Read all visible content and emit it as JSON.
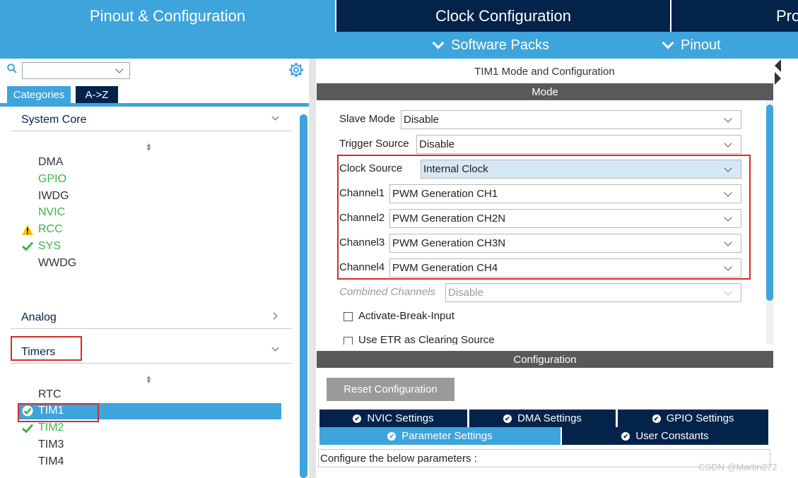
{
  "top_tabs": {
    "pinout": "Pinout & Configuration",
    "clock": "Clock Configuration",
    "project": "Project Manager"
  },
  "subbar": {
    "software_packs": "Software Packs",
    "pinout": "Pinout"
  },
  "left": {
    "search_value": "",
    "tabs": [
      "Categories",
      "A->Z"
    ],
    "sections": {
      "system_core": "System Core",
      "analog": "Analog",
      "timers": "Timers"
    },
    "system_core_items": [
      "DMA",
      "GPIO",
      "IWDG",
      "NVIC",
      "RCC",
      "SYS",
      "WWDG"
    ],
    "timer_items": [
      "RTC",
      "TIM1",
      "TIM2",
      "TIM3",
      "TIM4"
    ]
  },
  "right": {
    "title": "TIM1 Mode and Configuration",
    "mode_header": "Mode",
    "config_header": "Configuration",
    "fields": {
      "slave_mode": {
        "label": "Slave Mode",
        "value": "Disable"
      },
      "trigger_source": {
        "label": "Trigger Source",
        "value": "Disable"
      },
      "clock_source": {
        "label": "Clock Source",
        "value": "Internal Clock"
      },
      "channel1": {
        "label": "Channel1",
        "value": "PWM Generation CH1"
      },
      "channel2": {
        "label": "Channel2",
        "value": "PWM Generation CH2N"
      },
      "channel3": {
        "label": "Channel3",
        "value": "PWM Generation CH3N"
      },
      "channel4": {
        "label": "Channel4",
        "value": "PWM Generation CH4"
      },
      "combined": {
        "label": "Combined Channels",
        "value": "Disable"
      }
    },
    "checkboxes": {
      "activate_break": "Activate-Break-Input",
      "use_etr": "Use ETR as Clearing Source"
    },
    "reset_button": "Reset Configuration",
    "settings_tabs": {
      "nvic": "NVIC Settings",
      "dma": "DMA Settings",
      "gpio": "GPIO Settings",
      "parameter": "Parameter Settings",
      "user_constants": "User Constants"
    },
    "configure_text": "Configure the below parameters :"
  },
  "watermark": "CSDN @Martin272",
  "colors": {
    "accent": "#3ea4dc",
    "navy": "#03234b",
    "ok_green": "#3cb54a",
    "warn_yellow": "#f5c400",
    "highlight_red": "#d42b2b"
  }
}
